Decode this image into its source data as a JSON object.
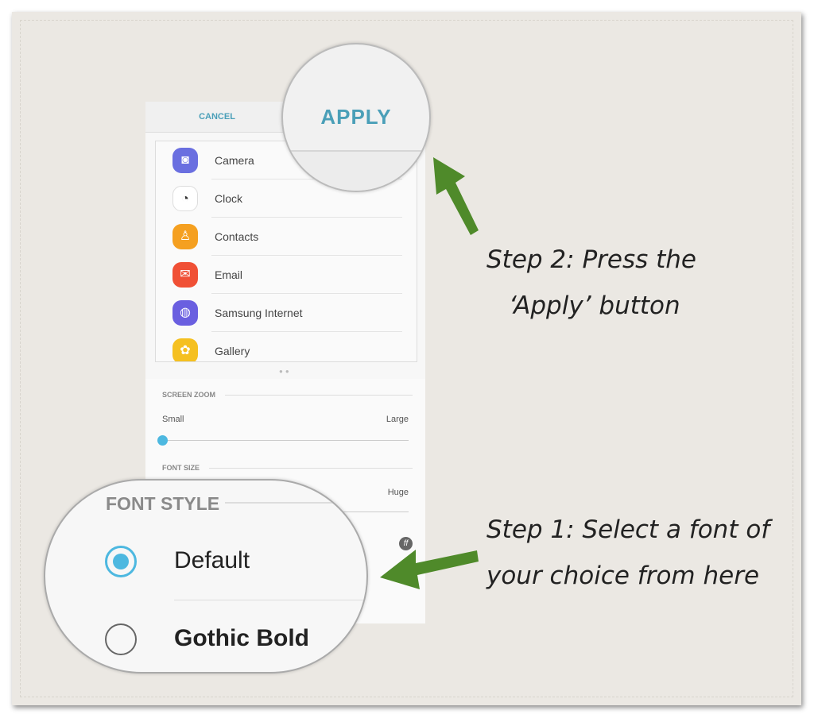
{
  "header": {
    "cancel_label": "CANCEL",
    "apply_label": "APPLY"
  },
  "apps": [
    {
      "label": "Camera",
      "icon": "camera-icon",
      "color": "#6a6fe0"
    },
    {
      "label": "Clock",
      "icon": "clock-icon",
      "color": "#ffffff"
    },
    {
      "label": "Contacts",
      "icon": "contacts-icon",
      "color": "#f5a020"
    },
    {
      "label": "Email",
      "icon": "email-icon",
      "color": "#f05035"
    },
    {
      "label": "Samsung Internet",
      "icon": "internet-icon",
      "color": "#6a5fe0"
    },
    {
      "label": "Gallery",
      "icon": "gallery-icon",
      "color": "#f5c020"
    }
  ],
  "screen_zoom": {
    "title": "SCREEN ZOOM",
    "min_label": "Small",
    "max_label": "Large",
    "value_fraction": 0
  },
  "font_size": {
    "title": "FONT SIZE",
    "max_label": "Huge"
  },
  "font_style": {
    "title": "FONT STYLE",
    "options": [
      {
        "label": "Default",
        "selected": true
      },
      {
        "label": "Gothic Bold",
        "selected": false
      }
    ]
  },
  "annotations": {
    "step2_line1": "Step 2: Press the",
    "step2_line2": "‘Apply’ button",
    "step1_line1": "Step 1: Select a font of",
    "step1_line2": "your choice from here"
  },
  "colors": {
    "accent": "#4a9fb8",
    "arrow": "#4f8a2a",
    "slider": "#4db8e0"
  }
}
